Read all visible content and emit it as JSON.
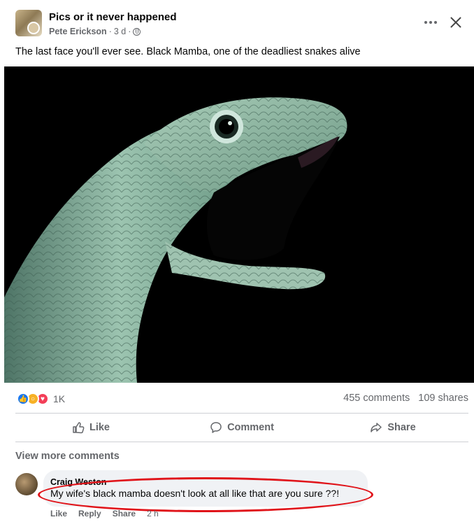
{
  "post": {
    "group_name": "Pics or it never happened",
    "author": "Pete Erickson",
    "time": "3 d",
    "separator": "·",
    "text": "The last face you'll ever see. Black Mamba, one of the deadliest snakes alive"
  },
  "reactions": {
    "count": "1K",
    "comments": "455 comments",
    "shares": "109 shares",
    "types": [
      "like",
      "wow",
      "love"
    ]
  },
  "actions": {
    "like": "Like",
    "comment": "Comment",
    "share": "Share"
  },
  "view_more": "View more comments",
  "comment": {
    "name": "Craig Weston",
    "text": "My wife's black mamba doesn't look at all like that are you sure ??!",
    "like": "Like",
    "reply": "Reply",
    "share": "Share",
    "time": "2 h"
  },
  "colors": {
    "accent": "#1877f2",
    "annotation": "#e0141a",
    "photo_bg": "#000000",
    "snake": "#8fb7a2"
  }
}
